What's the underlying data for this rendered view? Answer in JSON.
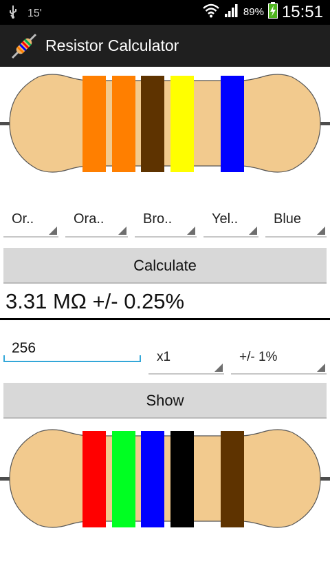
{
  "status_bar": {
    "usb_icon": "usb-icon",
    "temp": "15'",
    "battery_text": "89%",
    "time": "15:51"
  },
  "action_bar": {
    "title": "Resistor Calculator",
    "icon": "resistor-app-icon"
  },
  "decode": {
    "bands": [
      {
        "label": "Or..",
        "color": "#ff7f00"
      },
      {
        "label": "Ora..",
        "color": "#ff7f00"
      },
      {
        "label": "Bro..",
        "color": "#5e3300"
      },
      {
        "label": "Yel..",
        "color": "#ffff00"
      },
      {
        "label": "Blue",
        "color": "#0000ff"
      }
    ],
    "button_label": "Calculate",
    "result": "3.31 MΩ +/- 0.25%"
  },
  "encode": {
    "value": "256",
    "multiplier": "x1",
    "tolerance": "+/- 1%",
    "button_label": "Show",
    "bands": [
      {
        "color": "#ff0000"
      },
      {
        "color": "#00ff22"
      },
      {
        "color": "#0000ff"
      },
      {
        "color": "#000000"
      },
      {
        "color": "#5e3300"
      }
    ]
  },
  "colors": {
    "body": "#f2ca8e",
    "wire": "#4d4d4d",
    "accent": "#33a7d8"
  }
}
